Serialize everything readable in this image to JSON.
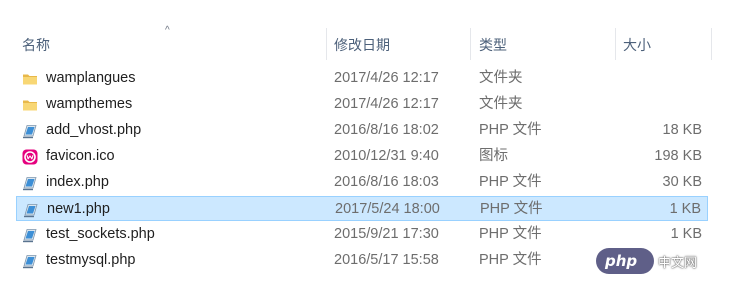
{
  "header": {
    "name": "名称",
    "modified": "修改日期",
    "type": "类型",
    "size": "大小",
    "sort_indicator": "^"
  },
  "files": [
    {
      "name": "wamplangues",
      "modified": "2017/4/26 12:17",
      "type": "文件夹",
      "size": "",
      "icon": "folder-icon"
    },
    {
      "name": "wampthemes",
      "modified": "2017/4/26 12:17",
      "type": "文件夹",
      "size": "",
      "icon": "folder-icon"
    },
    {
      "name": "add_vhost.php",
      "modified": "2016/8/16 18:02",
      "type": "PHP 文件",
      "size": "18 KB",
      "icon": "php-file-icon"
    },
    {
      "name": "favicon.ico",
      "modified": "2010/12/31 9:40",
      "type": "图标",
      "size": "198 KB",
      "icon": "wamp-icon"
    },
    {
      "name": "index.php",
      "modified": "2016/8/16 18:03",
      "type": "PHP 文件",
      "size": "30 KB",
      "icon": "php-file-icon"
    },
    {
      "name": "new1.php",
      "modified": "2017/5/24 18:00",
      "type": "PHP 文件",
      "size": "1 KB",
      "icon": "php-file-icon",
      "selected": true
    },
    {
      "name": "test_sockets.php",
      "modified": "2015/9/21 17:30",
      "type": "PHP 文件",
      "size": "1 KB",
      "icon": "php-file-icon"
    },
    {
      "name": "testmysql.php",
      "modified": "2016/5/17 15:58",
      "type": "PHP 文件",
      "size": "",
      "icon": "php-file-icon"
    }
  ],
  "watermark": {
    "brand": "php",
    "site": "中文网"
  },
  "colors": {
    "selection_bg": "#cce8ff",
    "selection_border": "#99d1ff",
    "header_text": "#4c607a",
    "folder": "#f8d775",
    "wamp_pink": "#e5007e"
  }
}
